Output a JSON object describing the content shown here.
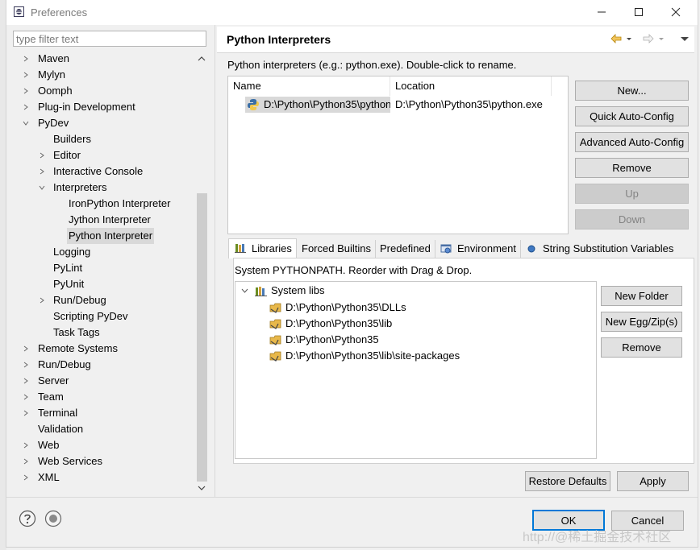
{
  "window": {
    "title": "Preferences"
  },
  "filter": {
    "placeholder": "type filter text"
  },
  "tree": [
    {
      "label": "Maven"
    },
    {
      "label": "Mylyn"
    },
    {
      "label": "Oomph"
    },
    {
      "label": "Plug-in Development"
    },
    {
      "label": "PyDev"
    },
    {
      "label": "Builders"
    },
    {
      "label": "Editor"
    },
    {
      "label": "Interactive Console"
    },
    {
      "label": "Interpreters"
    },
    {
      "label": "IronPython Interpreter"
    },
    {
      "label": "Jython Interpreter"
    },
    {
      "label": "Python Interpreter"
    },
    {
      "label": "Logging"
    },
    {
      "label": "PyLint"
    },
    {
      "label": "PyUnit"
    },
    {
      "label": "Run/Debug"
    },
    {
      "label": "Scripting PyDev"
    },
    {
      "label": "Task Tags"
    },
    {
      "label": "Remote Systems"
    },
    {
      "label": "Run/Debug"
    },
    {
      "label": "Server"
    },
    {
      "label": "Team"
    },
    {
      "label": "Terminal"
    },
    {
      "label": "Validation"
    },
    {
      "label": "Web"
    },
    {
      "label": "Web Services"
    },
    {
      "label": "XML"
    }
  ],
  "page": {
    "title": "Python Interpreters",
    "description": "Python interpreters (e.g.: python.exe).   Double-click to rename.",
    "columns": [
      "Name",
      "Location"
    ],
    "interpreters": [
      {
        "name": "D:\\Python\\Python35\\python",
        "location": "D:\\Python\\Python35\\python.exe"
      }
    ],
    "buttons": {
      "new": "New...",
      "quick": "Quick Auto-Config",
      "advanced": "Advanced Auto-Config",
      "remove": "Remove",
      "up": "Up",
      "down": "Down"
    },
    "tabs": [
      "Libraries",
      "Forced Builtins",
      "Predefined",
      "Environment",
      "String Substitution Variables"
    ],
    "libraries": {
      "description": "System PYTHONPATH.   Reorder with Drag & Drop.",
      "root": "System libs",
      "paths": [
        "D:\\Python\\Python35\\DLLs",
        "D:\\Python\\Python35\\lib",
        "D:\\Python\\Python35",
        "D:\\Python\\Python35\\lib\\site-packages"
      ],
      "buttons": {
        "new_folder": "New Folder",
        "new_egg": "New Egg/Zip(s)",
        "remove": "Remove"
      }
    },
    "restore_defaults": "Restore Defaults",
    "apply": "Apply"
  },
  "dialog": {
    "ok": "OK",
    "cancel": "Cancel"
  },
  "watermark": "http://@稀土掘金技术社区",
  "colors": {
    "accent": "#0078d7",
    "selection": "#d9d9d9",
    "folder": "#e8b84a"
  }
}
